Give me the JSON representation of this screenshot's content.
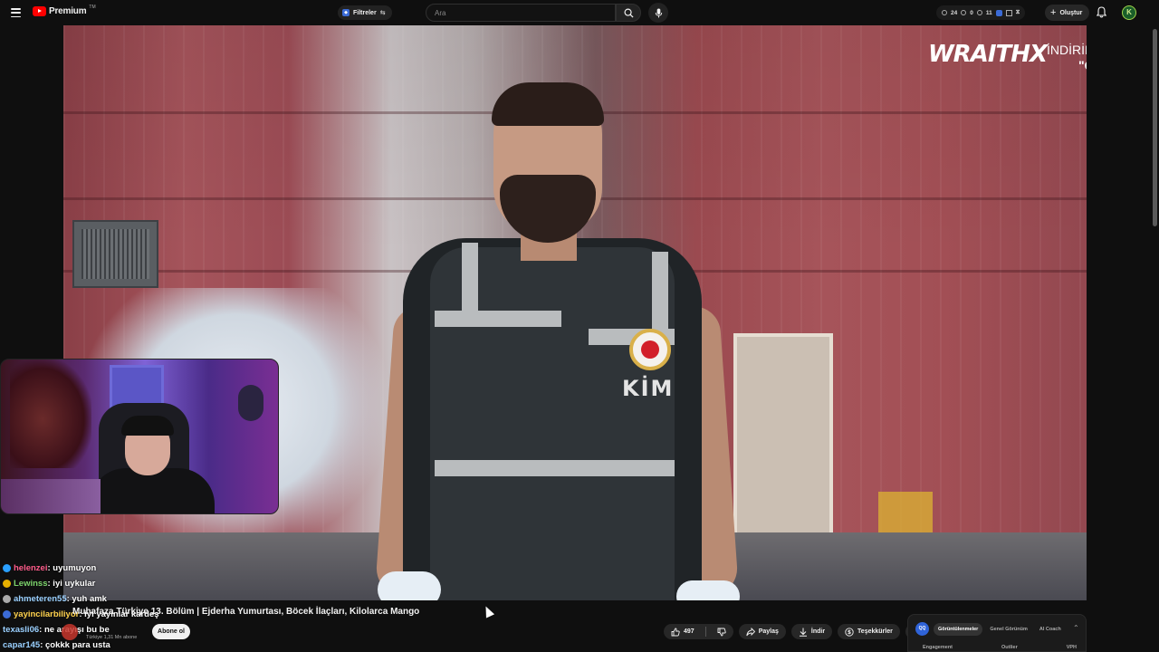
{
  "header": {
    "logo_text": "Premium",
    "logo_tm": "TM",
    "filter_label": "Filtreler",
    "search_placeholder": "Ara",
    "stats": {
      "a": "24",
      "b": "0",
      "c": "11"
    },
    "create_label": "Oluştur",
    "avatar_letter": "K"
  },
  "video": {
    "sponsor_logo": "WRAITH",
    "sponsor_logo_suffix": "X",
    "sponsor_line1": "İNDİRİM KODU:",
    "sponsor_line2": "\"QQ\"",
    "vest_text": "KİM"
  },
  "chat": [
    {
      "user": "helenzei",
      "user_color": "#ff5b8a",
      "badge_color": "#2aa0ff",
      "text": " : uyumuyon"
    },
    {
      "user": "Lewinss",
      "user_color": "#7cd36b",
      "badge_color": "#e6b000",
      "text": " : iyi uykular"
    },
    {
      "user": "ahmeteren55",
      "user_color": "#9ad0ff",
      "badge_color": "#aaaaaa",
      "text": " : yuh amk"
    },
    {
      "user": "yayincilarbiliyor",
      "user_color": "#ffd24d",
      "badge_color": "#3b6bd6",
      "text": " : iyi yayınlar kardeş"
    },
    {
      "user": "texasli06",
      "user_color": "#9ad0ff",
      "badge_color": "",
      "text": " : ne arayışı bu be"
    },
    {
      "user": "capar145",
      "user_color": "#9ad0ff",
      "badge_color": "",
      "text": " : çokkk para usta"
    }
  ],
  "info": {
    "title": "Muhafaza Türkiye 13. Bölüm | Ejderha Yumurtası, Böcek İlaçları, Kilolarca Mango",
    "channel_name": "Türkiye",
    "channel_subs": "1,31 Mn abone",
    "subscribe_label": "Abone ol",
    "like_count": "497",
    "share_label": "Paylaş",
    "download_label": "İndir",
    "thanks_label": "Teşekkürler"
  },
  "analytics": {
    "logo": "QQ",
    "tabs": [
      "Görüntülenmeler",
      "Genel Görünüm",
      "AI Coach"
    ],
    "columns": [
      "Engagement",
      "Outlier",
      "VPH"
    ]
  },
  "colors": {
    "brand_red": "#ff0000",
    "background": "#0f0f0f",
    "pill": "#272727"
  }
}
